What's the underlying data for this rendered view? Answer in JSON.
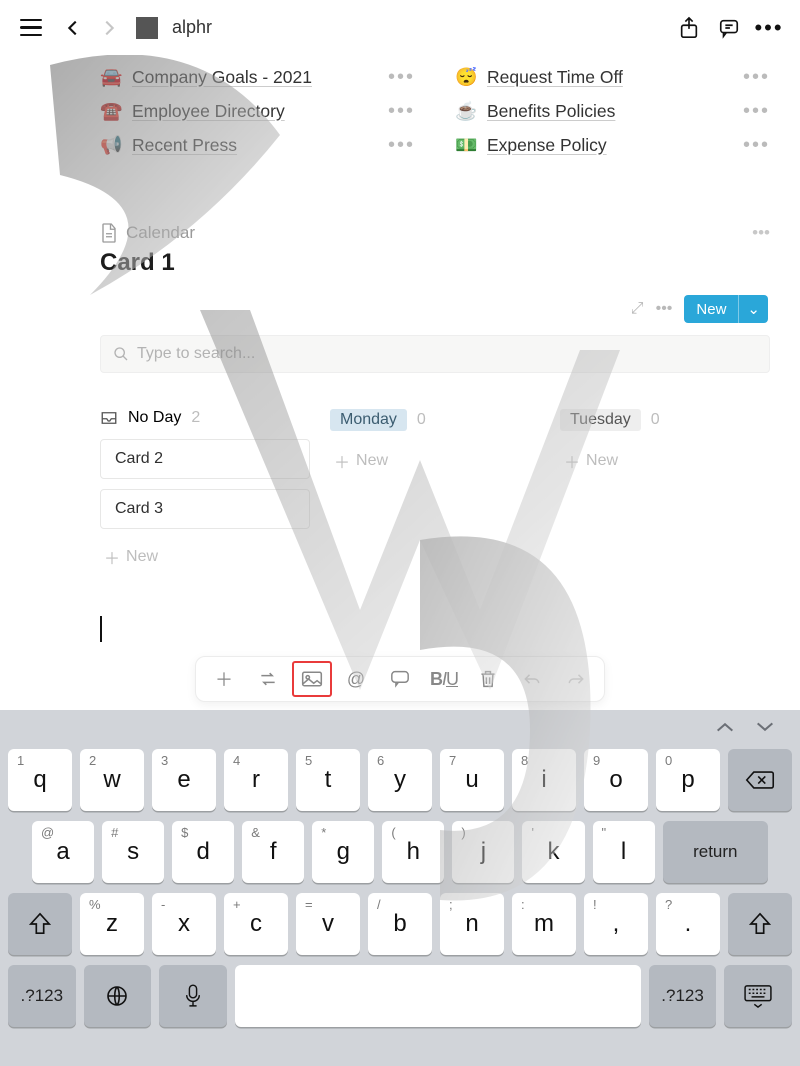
{
  "topbar": {
    "page_name": "alphr"
  },
  "links_left": [
    {
      "emoji": "🚘",
      "label": "Company Goals - 2021"
    },
    {
      "emoji": "☎️",
      "label": "Employee Directory"
    },
    {
      "emoji": "📢",
      "label": "Recent Press"
    }
  ],
  "links_right": [
    {
      "emoji": "😴",
      "label": "Request Time Off"
    },
    {
      "emoji": "☕",
      "label": "Benefits Policies"
    },
    {
      "emoji": "💵",
      "label": "Expense Policy"
    }
  ],
  "section": {
    "breadcrumb": "Calendar",
    "title": "Card 1",
    "new_btn": "New",
    "search_placeholder": "Type to search..."
  },
  "board": {
    "lanes": [
      {
        "id": "noday",
        "title": "No Day",
        "count": 2,
        "cards": [
          "Card 2",
          "Card 3"
        ]
      },
      {
        "id": "monday",
        "title": "Monday",
        "count": 0,
        "cards": []
      },
      {
        "id": "tuesday",
        "title": "Tuesday",
        "count": 0,
        "cards": []
      }
    ],
    "add_new_label": "New"
  },
  "toolbar_items": [
    "plus",
    "turn-into",
    "image",
    "mention",
    "comment",
    "biu",
    "delete",
    "undo",
    "redo"
  ],
  "keyboard": {
    "row1": [
      {
        "n": "1",
        "l": "q"
      },
      {
        "n": "2",
        "l": "w"
      },
      {
        "n": "3",
        "l": "e"
      },
      {
        "n": "4",
        "l": "r"
      },
      {
        "n": "5",
        "l": "t"
      },
      {
        "n": "6",
        "l": "y"
      },
      {
        "n": "7",
        "l": "u"
      },
      {
        "n": "8",
        "l": "i"
      },
      {
        "n": "9",
        "l": "o"
      },
      {
        "n": "0",
        "l": "p"
      }
    ],
    "row2": [
      {
        "n": "@",
        "l": "a"
      },
      {
        "n": "#",
        "l": "s"
      },
      {
        "n": "$",
        "l": "d"
      },
      {
        "n": "&",
        "l": "f"
      },
      {
        "n": "*",
        "l": "g"
      },
      {
        "n": "(",
        "l": "h"
      },
      {
        "n": ")",
        "l": "j"
      },
      {
        "n": "'",
        "l": "k"
      },
      {
        "n": "\"",
        "l": "l"
      }
    ],
    "row3": [
      {
        "n": "%",
        "l": "z"
      },
      {
        "n": "-",
        "l": "x"
      },
      {
        "n": "+",
        "l": "c"
      },
      {
        "n": "=",
        "l": "v"
      },
      {
        "n": "/",
        "l": "b"
      },
      {
        "n": ";",
        "l": "n"
      },
      {
        "n": ":",
        "l": "m"
      },
      {
        "n": "!",
        "l": ","
      },
      {
        "n": "?",
        "l": "."
      }
    ],
    "switch_label": ".?123",
    "return_label": "return"
  }
}
